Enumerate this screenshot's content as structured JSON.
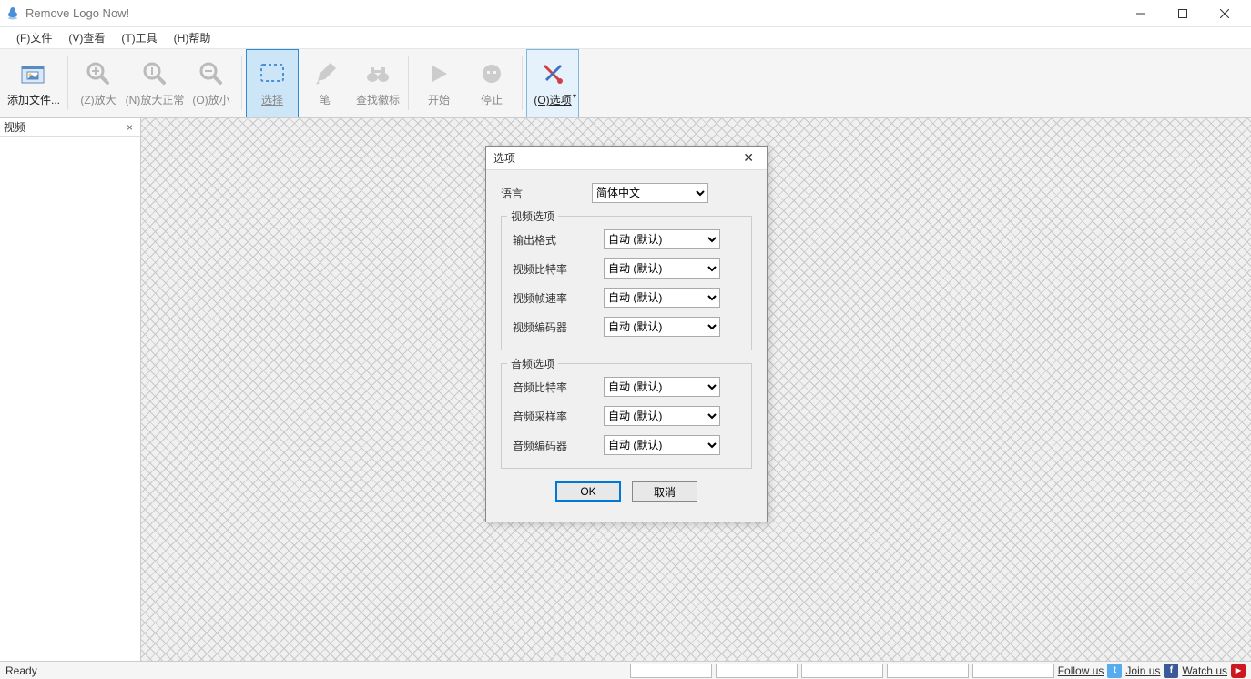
{
  "titlebar": {
    "title": "Remove Logo Now!"
  },
  "menubar": {
    "file": "(F)文件",
    "view": "(V)查看",
    "tools": "(T)工具",
    "help": "(H)帮助"
  },
  "toolbar": {
    "add_files": "添加文件...",
    "zoom_in": "(Z)放大",
    "zoom_normal": "(N)放大正常",
    "zoom_out": "(O)放小",
    "select": "选择",
    "pen": "笔",
    "find_logo": "查找徽标",
    "start": "开始",
    "stop": "停止",
    "options": "(O)选项"
  },
  "sidebar": {
    "title": "视频"
  },
  "dialog": {
    "title": "选项",
    "language_label": "语言",
    "language_value": "简体中文",
    "video_section": "视频选项",
    "output_format_label": "输出格式",
    "output_format_value": "自动 (默认)",
    "video_bitrate_label": "视频比特率",
    "video_bitrate_value": "自动 (默认)",
    "video_framerate_label": "视频帧速率",
    "video_framerate_value": "自动 (默认)",
    "video_encoder_label": "视频编码器",
    "video_encoder_value": "自动 (默认)",
    "audio_section": "音频选项",
    "audio_bitrate_label": "音频比特率",
    "audio_bitrate_value": "自动 (默认)",
    "audio_samplerate_label": "音频采样率",
    "audio_samplerate_value": "自动 (默认)",
    "audio_encoder_label": "音频编码器",
    "audio_encoder_value": "自动 (默认)",
    "ok": "OK",
    "cancel": "取消"
  },
  "statusbar": {
    "ready": "Ready",
    "follow": "Follow us",
    "join": "Join us",
    "watch": "Watch us"
  }
}
